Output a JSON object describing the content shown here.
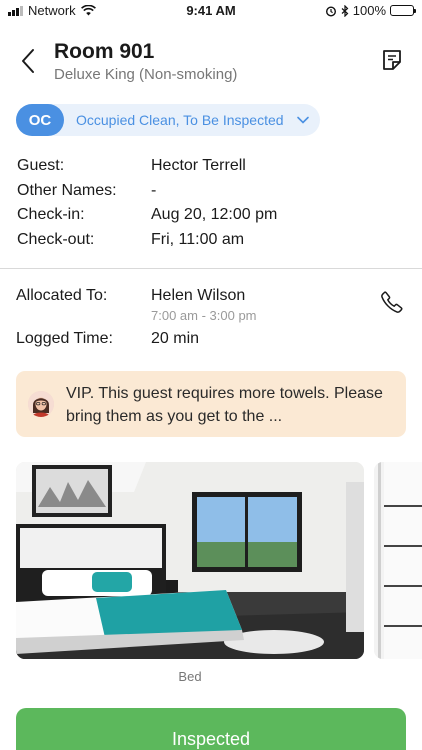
{
  "status_bar": {
    "carrier": "Network",
    "time": "9:41 AM",
    "battery": "100%"
  },
  "header": {
    "title": "Room 901",
    "subtitle": "Deluxe King (Non-smoking)"
  },
  "room_status": {
    "code": "OC",
    "label": "Occupied Clean, To Be Inspected",
    "accent": "#4a90e2"
  },
  "guest_info": [
    {
      "label": "Guest:",
      "value": "Hector Terrell"
    },
    {
      "label": "Other Names:",
      "value": "-"
    },
    {
      "label": "Check-in:",
      "value": "Aug 20, 12:00 pm"
    },
    {
      "label": "Check-out:",
      "value": "Fri, 11:00 am"
    }
  ],
  "allocation": {
    "allocated_label": "Allocated To:",
    "allocated_name": "Helen Wilson",
    "allocated_time": "7:00 am - 3:00 pm",
    "logged_label": "Logged Time:",
    "logged_value": "20 min"
  },
  "note": {
    "text": "VIP. This guest requires more towels. Please bring them as you get to the ..."
  },
  "photos": [
    {
      "caption": "Bed"
    }
  ],
  "actions": {
    "primary_label": "Inspected",
    "primary_color": "#5cb85c"
  }
}
